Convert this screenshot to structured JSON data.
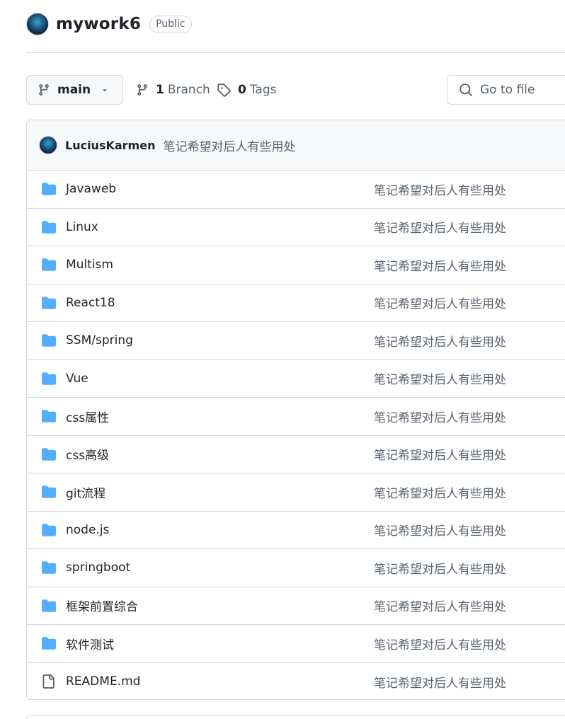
{
  "repo": {
    "name": "mywork6",
    "visibility": "Public"
  },
  "toolbar": {
    "branch": "main",
    "branches_count": "1",
    "branches_label": "Branch",
    "tags_count": "0",
    "tags_label": "Tags",
    "search_placeholder": "Go to file"
  },
  "latest_commit": {
    "author": "LuciusKarmen",
    "message": "笔记希望对后人有些用处"
  },
  "files": [
    {
      "name": "Javaweb",
      "type": "folder",
      "message": "笔记希望对后人有些用处"
    },
    {
      "name": "Linux",
      "type": "folder",
      "message": "笔记希望对后人有些用处"
    },
    {
      "name": "Multism",
      "type": "folder",
      "message": "笔记希望对后人有些用处"
    },
    {
      "name": "React18",
      "type": "folder",
      "message": "笔记希望对后人有些用处"
    },
    {
      "name": "SSM/spring",
      "type": "folder",
      "message": "笔记希望对后人有些用处"
    },
    {
      "name": "Vue",
      "type": "folder",
      "message": "笔记希望对后人有些用处"
    },
    {
      "name": "css属性",
      "type": "folder",
      "message": "笔记希望对后人有些用处"
    },
    {
      "name": "css高级",
      "type": "folder",
      "message": "笔记希望对后人有些用处"
    },
    {
      "name": "git流程",
      "type": "folder",
      "message": "笔记希望对后人有些用处"
    },
    {
      "name": "node.js",
      "type": "folder",
      "message": "笔记希望对后人有些用处"
    },
    {
      "name": "springboot",
      "type": "folder",
      "message": "笔记希望对后人有些用处"
    },
    {
      "name": "框架前置综合",
      "type": "folder",
      "message": "笔记希望对后人有些用处"
    },
    {
      "name": "软件测试",
      "type": "folder",
      "message": "笔记希望对后人有些用处"
    },
    {
      "name": "README.md",
      "type": "file",
      "message": "笔记希望对后人有些用处"
    }
  ],
  "colors": {
    "folder_icon": "#54aeff",
    "border": "#d1d9e0",
    "muted_text": "#59636e",
    "header_bg": "#f6f8fa"
  }
}
